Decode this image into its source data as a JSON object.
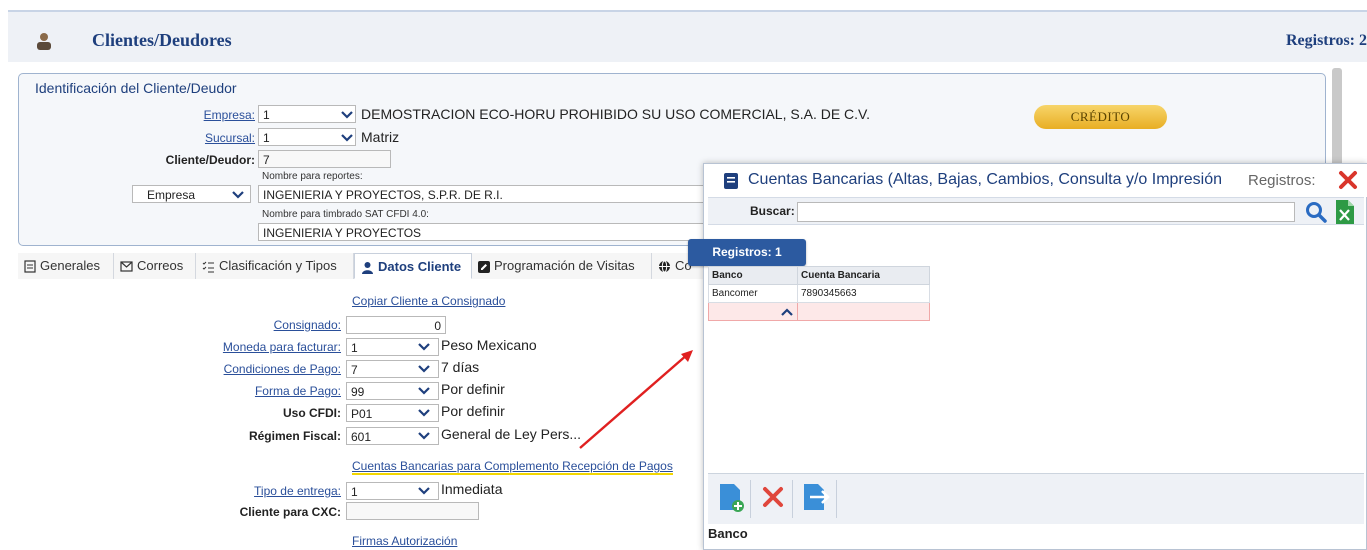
{
  "header": {
    "title": "Clientes/Deudores",
    "records_label": "Registros: 2"
  },
  "identification": {
    "legend": "Identificación del Cliente/Deudor",
    "empresa_label": "Empresa:",
    "empresa_value": "1",
    "empresa_desc": "DEMOSTRACION ECO-HORU PROHIBIDO SU USO COMERCIAL, S.A. DE C.V.",
    "sucursal_label": "Sucursal:",
    "sucursal_value": "1",
    "sucursal_desc": "Matriz",
    "cliente_label": "Cliente/Deudor:",
    "cliente_value": "7",
    "tipo_select": "Empresa",
    "nombre_reportes_caption": "Nombre para reportes:",
    "nombre_reportes_value": "INGENIERIA Y PROYECTOS, S.P.R. DE R.I.",
    "nombre_timbrado_caption": "Nombre para timbrado SAT CFDI 4.0:",
    "nombre_timbrado_value": "INGENIERIA Y PROYECTOS",
    "credit_badge": "CRÉDITO"
  },
  "tabs": [
    {
      "label": "Generales"
    },
    {
      "label": "Correos"
    },
    {
      "label": "Clasificación y Tipos"
    },
    {
      "label": "Datos Cliente"
    },
    {
      "label": "Programación de Visitas"
    },
    {
      "label": "Co"
    }
  ],
  "datos_cliente": {
    "copy_link": "Copiar Cliente a Consignado",
    "consignado_label": "Consignado:",
    "consignado_value": "0",
    "moneda_label": "Moneda para facturar:",
    "moneda_value": "1",
    "moneda_desc": "Peso Mexicano",
    "condiciones_label": "Condiciones de Pago:",
    "condiciones_value": "7",
    "condiciones_desc": "7 días",
    "forma_label": "Forma de Pago:",
    "forma_value": "99",
    "forma_desc": "Por definir",
    "uso_label": "Uso CFDI:",
    "uso_value": "P01",
    "uso_desc": "Por definir",
    "regimen_label": "Régimen Fiscal:",
    "regimen_value": "601",
    "regimen_desc": "General de Ley Pers...",
    "cuentas_link": "Cuentas Bancarias para Complemento Recepción de Pagos",
    "entrega_label": "Tipo de entrega:",
    "entrega_value": "1",
    "entrega_desc": "Inmediata",
    "cxc_label": "Cliente para CXC:",
    "cxc_value": "",
    "firmas_link": "Firmas Autorización"
  },
  "modal": {
    "title": "Cuentas Bancarias (Altas, Bajas, Cambios, Consulta y/o Impresión",
    "records_label": "Registros:",
    "search_label": "Buscar:",
    "search_value": "",
    "records_pill": "Registros: 1",
    "columns": [
      "Banco",
      "Cuenta Bancaria"
    ],
    "rows": [
      {
        "banco": "Bancomer",
        "cuenta": "7890345663"
      }
    ],
    "footer_label": "Banco"
  },
  "colors": {
    "brand": "#1e3f7d",
    "link": "#2a4f9a",
    "accent_pill": "#2c5aa0",
    "close": "#d9352b",
    "arrow": "#e02020"
  }
}
